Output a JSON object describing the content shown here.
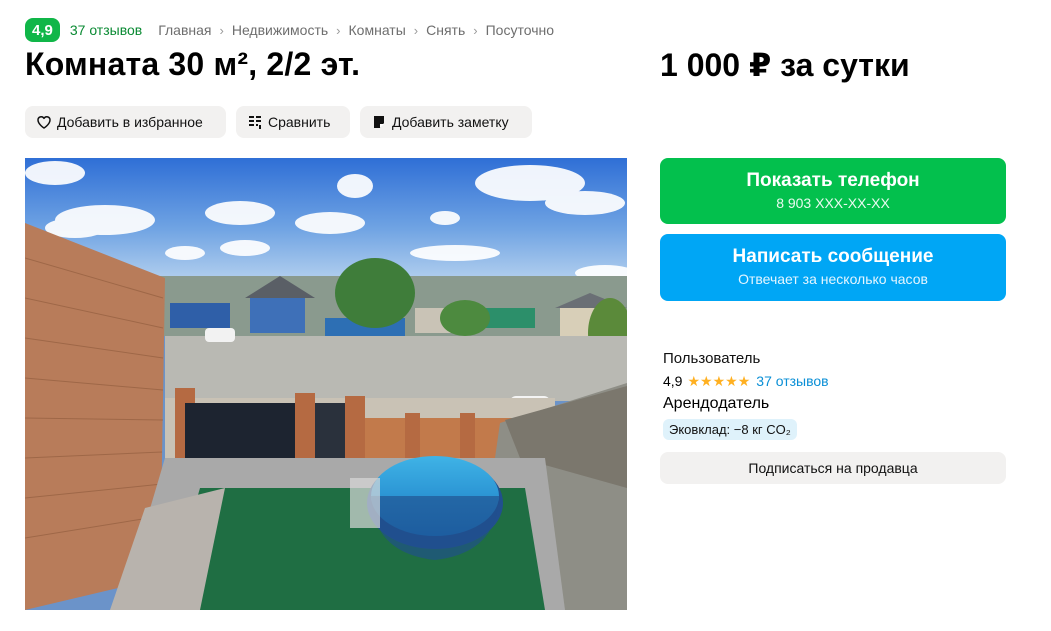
{
  "header": {
    "rating": "4,9",
    "reviews": "37 отзывов",
    "breadcrumb": [
      "Главная",
      "Недвижимость",
      "Комнаты",
      "Снять",
      "Посуточно"
    ]
  },
  "listing": {
    "title": "Комната 30 м², 2/2 эт.",
    "price": "1 000 ₽ за сутки"
  },
  "actions": {
    "favorite": "Добавить в избранное",
    "compare": "Сравнить",
    "note": "Добавить заметку"
  },
  "photo": {
    "description_icon": "listing-photo"
  },
  "contact": {
    "phone_label": "Показать телефон",
    "phone_number": "8 903 XXX-XX-XX",
    "message_label": "Написать сообщение",
    "message_sub": "Отвечает за несколько часов"
  },
  "seller": {
    "name": "Пользователь",
    "rating": "4,9",
    "stars": 5,
    "reviews": "37 отзывов",
    "role": "Арендодатель",
    "eco": "Эковклад: −8 кг CO₂",
    "subscribe": "Подписаться на продавца"
  },
  "colors": {
    "brand_green": "#03c04d",
    "badge_green": "#10b648",
    "message_blue": "#00a6f5",
    "star": "#ffb021"
  }
}
